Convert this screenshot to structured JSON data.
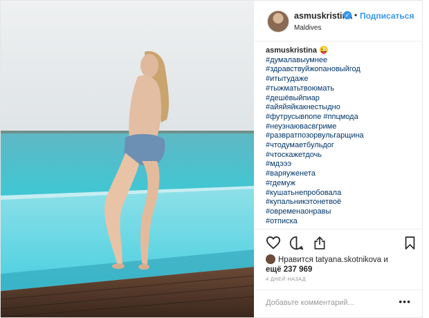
{
  "header": {
    "username": "asmuskristina",
    "follow_label": "Подписаться",
    "location": "Maldives"
  },
  "caption": {
    "author": "asmuskristina",
    "emoji": "😜",
    "hashtags": [
      "#думалавыумнее",
      "#здравствуйжопановыйгод",
      "#итытудаже",
      "#тыжматьтвоюмать",
      "#дешёвыйпиар",
      "#айяйяйкакнестыдно",
      "#футрусывпопе #ппцмода",
      "#неузнаювасвгриме",
      "#развратпозорвульгарщина",
      "#чтодумаетбульдог",
      "#чтоскажетдочь",
      "#мдэээ",
      "#варяуженета",
      "#гдемуж",
      "#кушатьнепробовала",
      "#купальникэтонетвоё",
      "#овременаонравы",
      "#отписка"
    ]
  },
  "likes": {
    "prefix": "Нравится tatyana.skotnikova и",
    "count": "ещё 237 969"
  },
  "timestamp": "4 ДНЕЙ НАЗАД",
  "comment": {
    "placeholder": "Добавьте комментарий...",
    "more": "•••"
  },
  "colors": {
    "link": "#3897f0",
    "hashtag": "#003569"
  },
  "icons": [
    "heart-icon",
    "comment-icon",
    "share-icon",
    "bookmark-icon",
    "verified-icon"
  ]
}
